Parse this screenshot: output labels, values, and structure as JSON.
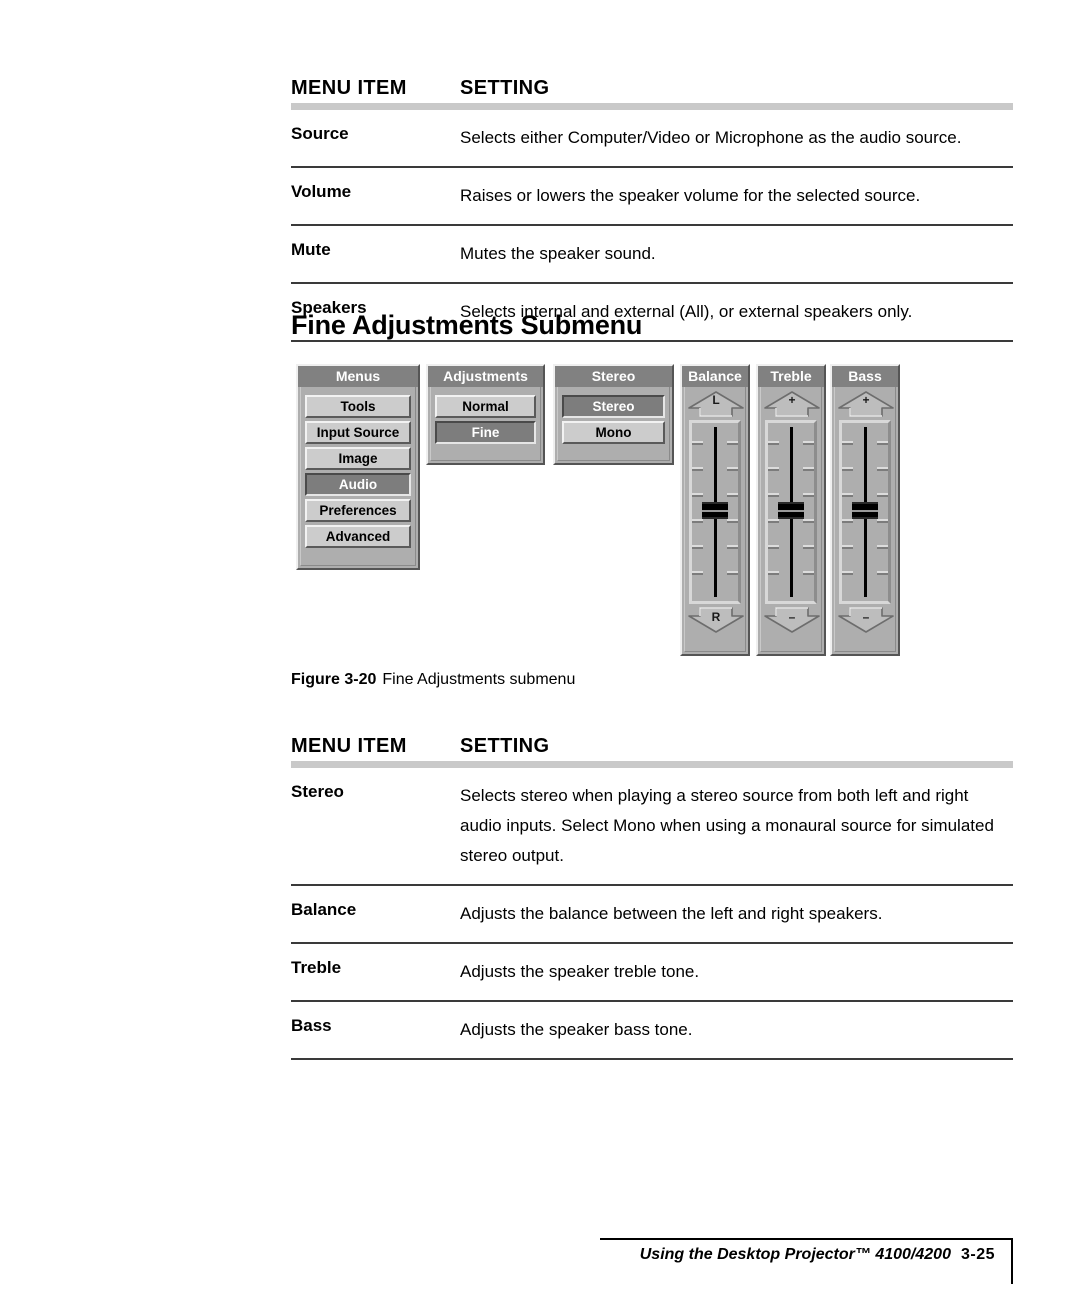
{
  "audio_table": {
    "columns": {
      "item": "MENU ITEM",
      "setting": "SETTING"
    },
    "rows": [
      {
        "item": "Source",
        "setting": "Selects either Computer/Video or Microphone as the audio source."
      },
      {
        "item": "Volume",
        "setting": "Raises or lowers the speaker volume for the selected source."
      },
      {
        "item": "Mute",
        "setting": "Mutes the speaker sound."
      },
      {
        "item": "Speakers",
        "setting": "Selects internal and external (All), or external speakers only."
      }
    ]
  },
  "section": {
    "heading": "Fine Adjustments Submenu"
  },
  "figure": {
    "caption_label": "Figure 3-20",
    "caption_text": "Fine Adjustments submenu",
    "menus_panel": {
      "title": "Menus",
      "items": [
        {
          "label": "Tools",
          "selected": false
        },
        {
          "label": "Input Source",
          "selected": false
        },
        {
          "label": "Image",
          "selected": false
        },
        {
          "label": "Audio",
          "selected": true
        },
        {
          "label": "Preferences",
          "selected": false
        },
        {
          "label": "Advanced",
          "selected": false
        }
      ]
    },
    "adjustments_panel": {
      "title": "Adjustments",
      "items": [
        {
          "label": "Normal",
          "selected": false
        },
        {
          "label": "Fine",
          "selected": true
        }
      ]
    },
    "stereo_panel": {
      "title": "Stereo",
      "items": [
        {
          "label": "Stereo",
          "selected": true
        },
        {
          "label": "Mono",
          "selected": false
        }
      ]
    },
    "sliders": [
      {
        "title": "Balance",
        "up_label": "L",
        "down_label": "R",
        "value_percent": 50
      },
      {
        "title": "Treble",
        "up_label": "+",
        "down_label": "–",
        "value_percent": 50
      },
      {
        "title": "Bass",
        "up_label": "+",
        "down_label": "–",
        "value_percent": 50
      }
    ]
  },
  "fine_table": {
    "columns": {
      "item": "MENU ITEM",
      "setting": "SETTING"
    },
    "rows": [
      {
        "item": "Stereo",
        "setting": "Selects stereo when playing a stereo source from both left and right audio inputs. Select Mono when using a monaural source for simulated stereo output."
      },
      {
        "item": "Balance",
        "setting": "Adjusts the balance between the left and right speakers."
      },
      {
        "item": "Treble",
        "setting": "Adjusts the speaker treble tone."
      },
      {
        "item": "Bass",
        "setting": "Adjusts the speaker bass tone."
      }
    ]
  },
  "footer": {
    "title": "Using the Desktop Projector™ 4100/4200",
    "page": "3-25"
  },
  "colors": {
    "panel_face": "#aeaeae",
    "panel_header": "#818181",
    "button_face": "#cccccc",
    "button_selected": "#7d7d7d",
    "rule": "#c9c9c9",
    "divider": "#3a3a3a"
  }
}
